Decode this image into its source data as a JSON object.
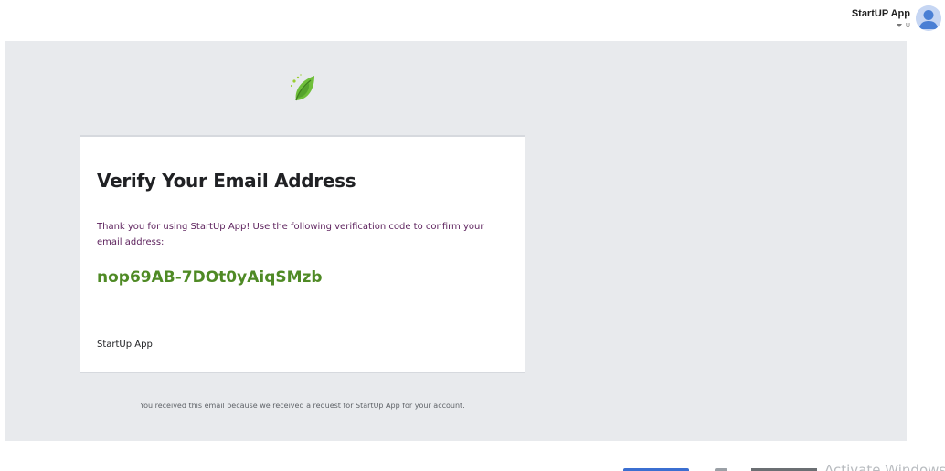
{
  "account": {
    "name": "StartUP App",
    "sub_label": "U",
    "icons": {
      "caret": "caret-down-icon",
      "avatar": "avatar-icon"
    }
  },
  "email": {
    "logo_icon": "leaf-logo-icon",
    "title": "Verify Your Email Address",
    "body": "Thank you for using StartUp App! Use the following verification code to confirm your email address:",
    "code": "nop69AB-7DOt0yAiqSMzb",
    "signature": "StartUp App",
    "footer": "You received this email because we received a request for StartUp App for your account."
  },
  "bottom_overlay": {
    "text": "Activate Windows"
  },
  "colors": {
    "canvas_bg": "#e8eaed",
    "code_green": "#4f8a25",
    "body_text": "#5b1f5b",
    "avatar_blue": "#4a7fd4"
  }
}
